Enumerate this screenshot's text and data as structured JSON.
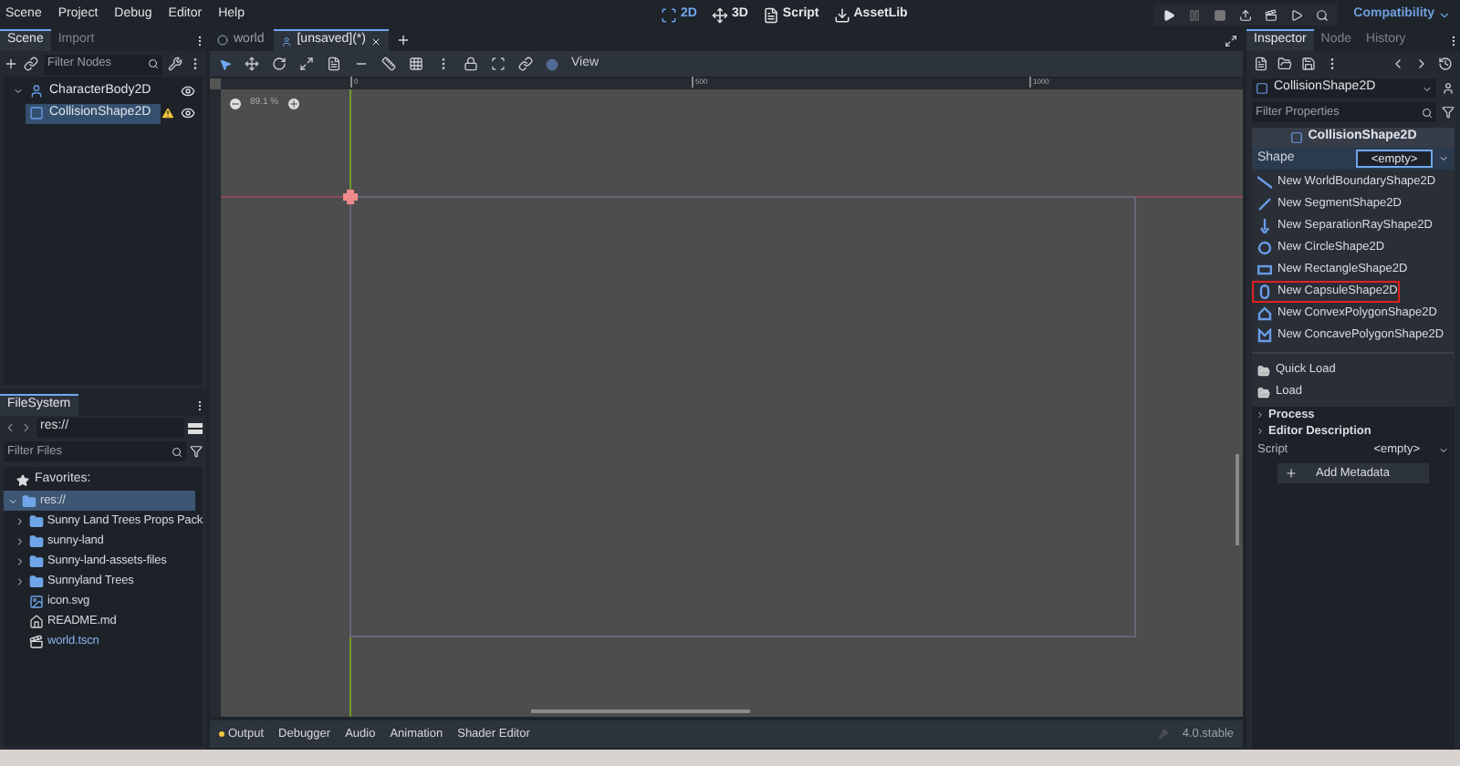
{
  "menu": [
    "Scene",
    "Project",
    "Debug",
    "Editor",
    "Help"
  ],
  "workspaces": [
    {
      "label": "2D",
      "kind": "planar",
      "selected": true
    },
    {
      "label": "3D",
      "kind": "spatial",
      "selected": false
    },
    {
      "label": "Script",
      "kind": "script",
      "selected": false
    },
    {
      "label": "AssetLib",
      "kind": "assetlib",
      "selected": false
    }
  ],
  "renderer": "Compatibility",
  "scene_dock": {
    "tabs": [
      {
        "label": "Scene",
        "selected": true
      },
      {
        "label": "Import",
        "selected": false
      }
    ],
    "filter_placeholder": "Filter Nodes",
    "tree": [
      {
        "name": "CharacterBody2D",
        "kind": "body",
        "selected": false,
        "warning": false,
        "children": [
          {
            "name": "CollisionShape2D",
            "kind": "shape",
            "selected": true,
            "warning": true
          }
        ]
      }
    ]
  },
  "filesystem": {
    "tab": "FileSystem",
    "path": "res://",
    "filter_placeholder": "Filter Files",
    "favorites": "Favorites:",
    "tree": [
      {
        "name": "res://",
        "kind": "folder",
        "selected": true,
        "children": [
          {
            "name": "Sunny Land Trees Props Pack",
            "kind": "folder",
            "selected": false
          },
          {
            "name": "sunny-land",
            "kind": "folder",
            "selected": false
          },
          {
            "name": "Sunny-land-assets-files",
            "kind": "folder",
            "selected": false
          },
          {
            "name": "Sunnyland Trees",
            "kind": "folder",
            "selected": false
          },
          {
            "name": "icon.svg",
            "kind": "image",
            "selected": false
          },
          {
            "name": "README.md",
            "kind": "doc",
            "selected": false
          },
          {
            "name": "world.tscn",
            "kind": "scene",
            "selected": false
          }
        ]
      }
    ]
  },
  "editor_tabs": [
    {
      "label": "world",
      "kind": "world",
      "selected": false
    },
    {
      "label": "[unsaved](*)",
      "kind": "unsaved",
      "selected": true
    }
  ],
  "view_menu": "View",
  "viewport": {
    "zoom": "89.1 %",
    "ruler_labels": [
      "0",
      "500",
      "1000"
    ]
  },
  "bottom_panel": {
    "tabs": [
      "Output",
      "Debugger",
      "Audio",
      "Animation",
      "Shader Editor"
    ],
    "version": "4.0.stable"
  },
  "inspector": {
    "tabs": [
      {
        "label": "Inspector",
        "selected": true
      },
      {
        "label": "Node",
        "selected": false
      },
      {
        "label": "History",
        "selected": false
      }
    ],
    "node": "CollisionShape2D",
    "filter_placeholder": "Filter Properties",
    "section": "CollisionShape2D",
    "property": {
      "label": "Shape",
      "value": "<empty>"
    },
    "menu_items": [
      {
        "label": "New WorldBoundaryShape2D",
        "kind": "boundary",
        "outlined": false
      },
      {
        "label": "New SegmentShape2D",
        "kind": "segment",
        "outlined": false
      },
      {
        "label": "New SeparationRayShape2D",
        "kind": "ray",
        "outlined": false
      },
      {
        "label": "New CircleShape2D",
        "kind": "circle",
        "outlined": false
      },
      {
        "label": "New RectangleShape2D",
        "kind": "rectangle",
        "outlined": false
      },
      {
        "label": "New CapsuleShape2D",
        "kind": "capsule",
        "outlined": true
      },
      {
        "label": "New ConvexPolygonShape2D",
        "kind": "convex",
        "outlined": false
      },
      {
        "label": "New ConcavePolygonShape2D",
        "kind": "concave",
        "outlined": false
      }
    ],
    "load_items": [
      "Quick Load",
      "Load"
    ],
    "groups": [
      "Process",
      "Editor Description"
    ],
    "script": {
      "label": "Script",
      "value": "<empty>"
    },
    "add_metadata": "Add Metadata"
  }
}
